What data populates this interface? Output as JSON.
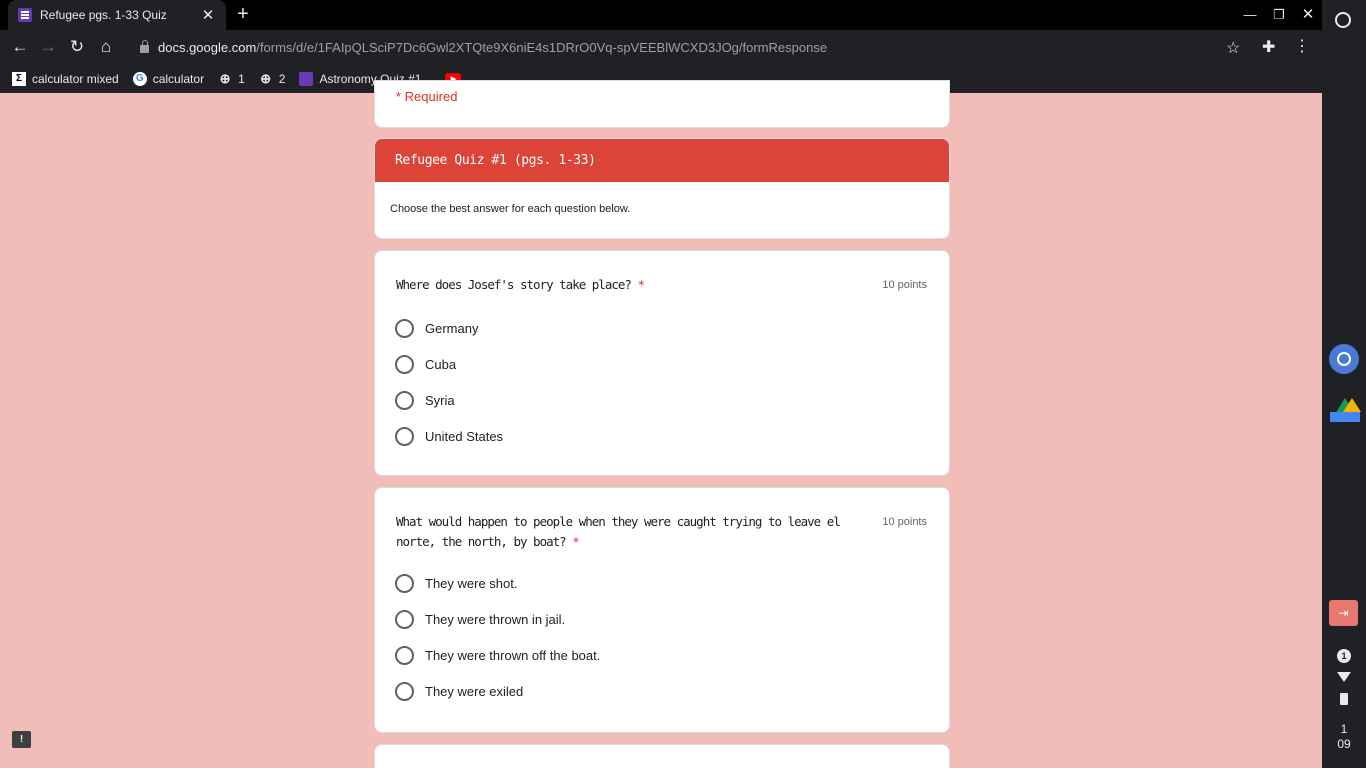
{
  "browser": {
    "tab_title": "Refugee pgs. 1-33 Quiz",
    "url_host": "docs.google.com",
    "url_path": "/forms/d/e/1FAIpQLSciP7Dc6Gwl2XTQte9X6niE4s1DRrO0Vq-spVEEBlWCXD3JOg/formResponse",
    "bookmarks": [
      {
        "label": "calculator mixed",
        "icon": "desmos-icon"
      },
      {
        "label": "calculator",
        "icon": "google-icon"
      },
      {
        "label": "1",
        "icon": "globe-icon"
      },
      {
        "label": "2",
        "icon": "globe-icon"
      },
      {
        "label": "Astronomy Quiz #1...",
        "icon": "forms-icon"
      },
      {
        "label": "",
        "icon": "youtube-icon"
      }
    ]
  },
  "shelf": {
    "notification_count": "1",
    "time_hour": "1",
    "time_minute": "09"
  },
  "form": {
    "required_note": "* Required",
    "section_title": "Refugee Quiz #1 (pgs. 1-33)",
    "section_description": "Choose the best answer for each question below.",
    "questions": [
      {
        "title": "Where does Josef's story take place?",
        "required_mark": "*",
        "points": "10 points",
        "options": [
          "Germany",
          "Cuba",
          "Syria",
          "United States"
        ]
      },
      {
        "title": "What would happen to people when they were caught trying to leave el norte, the north, by boat?",
        "required_mark": "*",
        "points": "10 points",
        "options": [
          "They were shot.",
          "They were thrown in jail.",
          "They were thrown off the boat.",
          "They were exiled"
        ]
      }
    ]
  },
  "colors": {
    "page_bg": "#f2bdb9",
    "section_header": "#db4437",
    "required": "#d93025"
  }
}
